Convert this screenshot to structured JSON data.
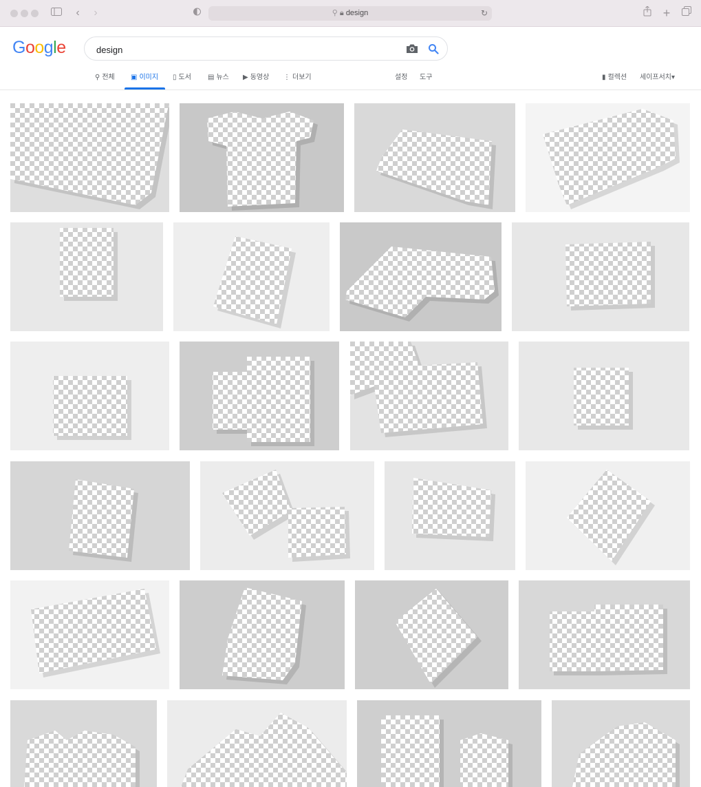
{
  "browser": {
    "url_text": "design",
    "icons": [
      "sidebar-icon",
      "back-icon",
      "forward-icon",
      "shield-icon",
      "search-icon",
      "lock-icon",
      "reload-icon",
      "share-icon",
      "plus-icon",
      "tabs-icon"
    ]
  },
  "search": {
    "query": "design",
    "logo": "Google",
    "logo_colors": [
      "#4285F4",
      "#EA4335",
      "#FBBC05",
      "#4285F4",
      "#34A853",
      "#EA4335"
    ]
  },
  "tabs": [
    {
      "label": "전체",
      "icon": "search-icon"
    },
    {
      "label": "이미지",
      "icon": "image-icon",
      "active": true
    },
    {
      "label": "도서",
      "icon": "book-icon"
    },
    {
      "label": "뉴스",
      "icon": "news-icon"
    },
    {
      "label": "동영상",
      "icon": "video-icon"
    },
    {
      "label": "더보기",
      "icon": "more-icon"
    }
  ],
  "tools": {
    "settings": "설정",
    "tools": "도구"
  },
  "right_links": {
    "collection": "컬렉션",
    "safesearch": "세이프서치▾"
  },
  "colors": {
    "accent": "#1a73e8",
    "tile_bg": "#dcdcdc",
    "checker": "#cfcfcf"
  },
  "image_results": [
    "tilted-sheet-mockup",
    "t-shirt-mockup",
    "square-sheet-mockup",
    "cd-sleeve-mockup",
    "easel-poster-mockup",
    "poster-mockup",
    "folded-paper-mockup",
    "laptop-mockup",
    "shopping-bag-mockup",
    "brochure-mockup",
    "folded-flyer-mockup",
    "mug-mockup",
    "corner-poster-mockup",
    "box-mockup",
    "monitor-mockup",
    "card-mockup",
    "tablet-mockup",
    "stacked-cards-mockup",
    "tilted-card-mockup",
    "folder-mockup",
    "paper-mockup",
    "envelope-mockup",
    "boxes-mockup",
    "card-corner-mockup"
  ]
}
